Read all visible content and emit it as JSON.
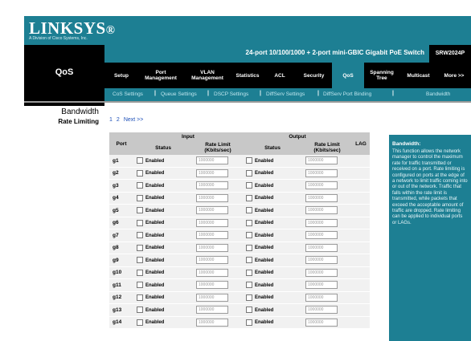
{
  "brand": {
    "logo_main": "LINKSYS",
    "logo_reg": "®",
    "logo_sub": "A Division of Cisco Systems, Inc."
  },
  "section_title": "QoS",
  "header": {
    "product": "24-port 10/100/1000 + 2-port mini-GBIC Gigabit PoE Switch",
    "model": "SRW2024P"
  },
  "nav": {
    "setup": "Setup",
    "port_mgmt": [
      "Port",
      "Management"
    ],
    "vlan_mgmt": [
      "VLAN",
      "Management"
    ],
    "statistics": "Statistics",
    "acl": "ACL",
    "security": "Security",
    "qos": "QoS",
    "spanning_tree": [
      "Spanning",
      "Tree"
    ],
    "multicast": "Multicast",
    "more": "More >>"
  },
  "subnav": {
    "cos": "CoS Settings",
    "queue": "Queue Settings",
    "dscp": "DSCP Settings",
    "diffserv": "DiffServ Settings",
    "diffserv_port": "DiffServ Port Binding",
    "bandwidth": "Bandwidth",
    "separator": "|"
  },
  "leftnav": {
    "item1": "Bandwidth",
    "item2": "Rate Limiting"
  },
  "pager": {
    "page1": "1",
    "page2": "2",
    "next": "Next >>"
  },
  "table": {
    "port_header": "Port",
    "input_header": "Input",
    "output_header": "Output",
    "lag_header": "LAG",
    "status_header": "Status",
    "rate_header_line1": "Rate Limit",
    "rate_header_line2": "(Kbits/sec)",
    "enabled_label": "Enabled",
    "rate_value": "1000000",
    "rows": [
      "g1",
      "g2",
      "g3",
      "g4",
      "g5",
      "g6",
      "g7",
      "g8",
      "g9",
      "g10",
      "g11",
      "g12",
      "g13",
      "g14"
    ]
  },
  "help": {
    "title": "Bandwidth:",
    "body": "This function allows the network manager to control the maximum rate for traffic transmitted or received on a port. Rate limiting is configured on ports at the edge of a network to limit traffic coming into or out of the network. Traffic that falls within the rate limit is transmitted, while packets that exceed the acceptable amount of traffic are dropped. Rate limiting can be applied to individual ports or LAGs."
  }
}
